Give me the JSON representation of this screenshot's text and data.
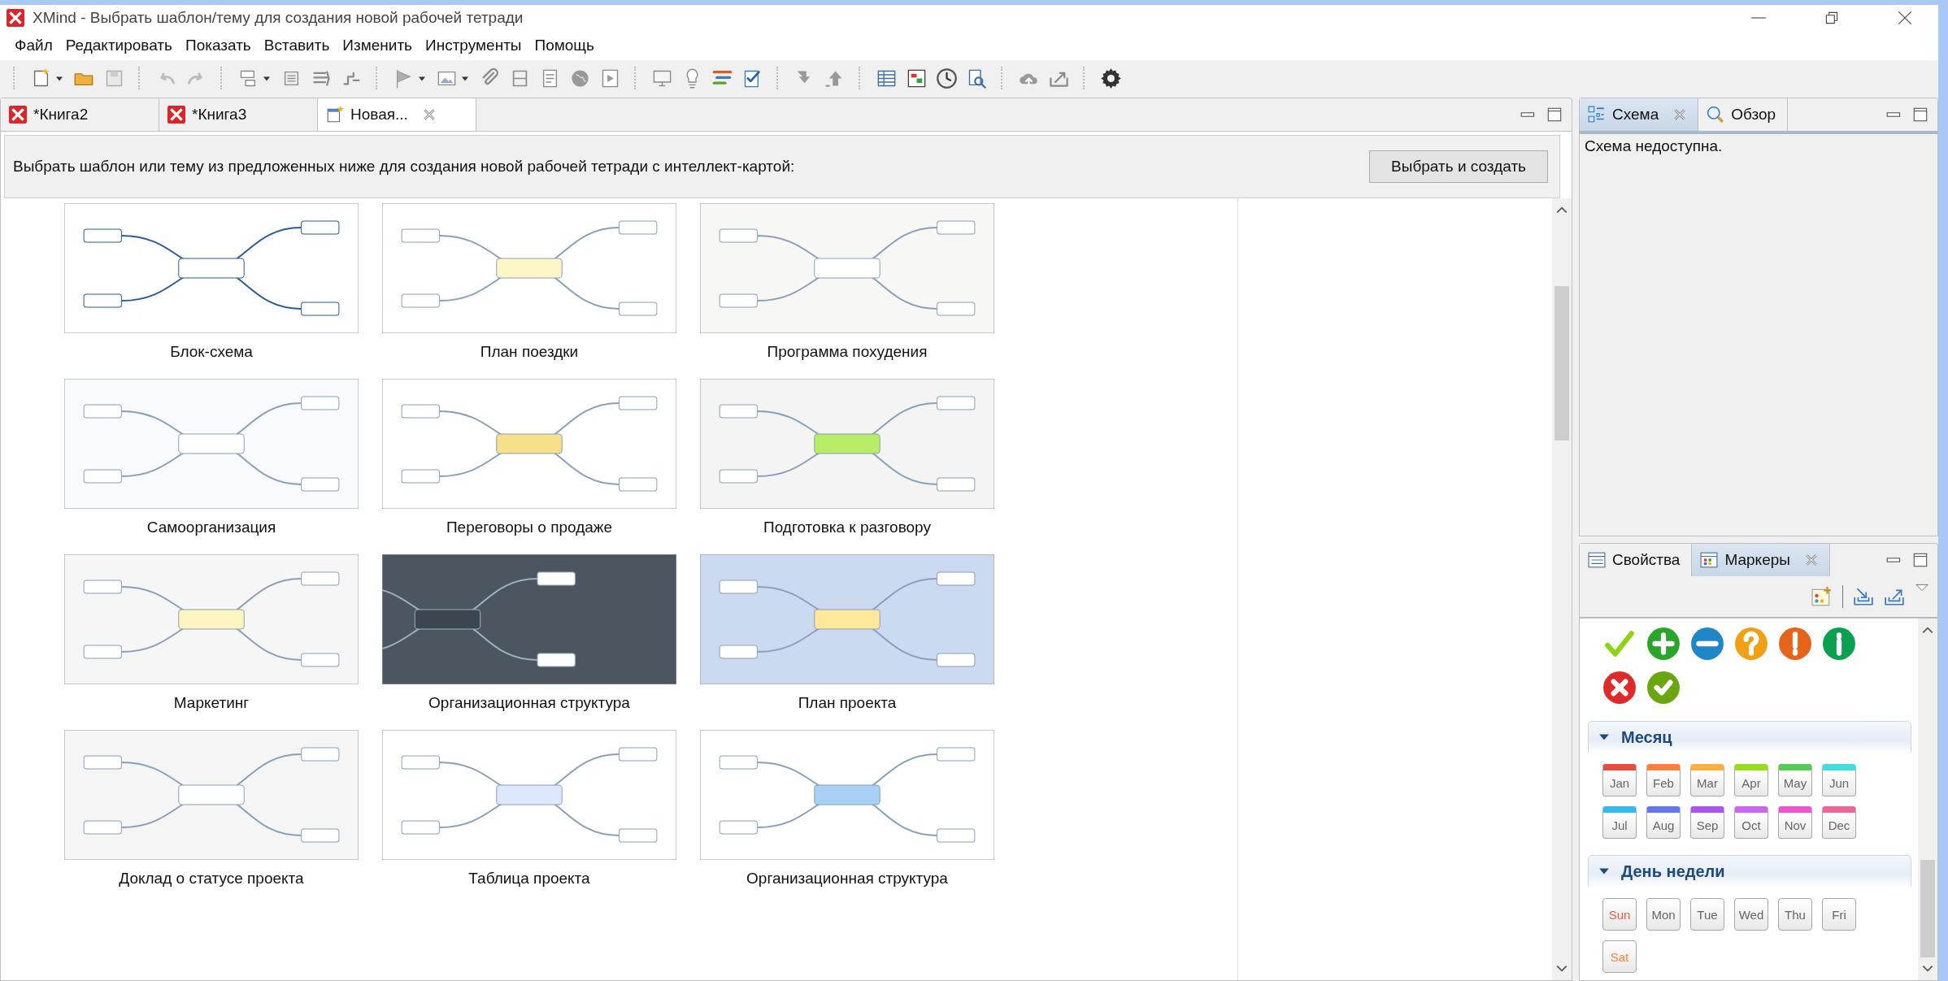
{
  "window": {
    "title": "XMind - Выбрать шаблон/тему для создания новой рабочей тетради"
  },
  "menu": [
    "Файл",
    "Редактировать",
    "Показать",
    "Вставить",
    "Изменить",
    "Инструменты",
    "Помощь"
  ],
  "editor_tabs": [
    {
      "label": "*Книга2",
      "kind": "workbook",
      "selected": false
    },
    {
      "label": "*Книга3",
      "kind": "workbook",
      "selected": false
    },
    {
      "label": "Новая...",
      "kind": "new",
      "selected": true
    }
  ],
  "template_chooser": {
    "prompt": "Выбрать шаблон или тему из предложенных ниже для создания новой рабочей тетради с интеллект-картой:",
    "button": "Выбрать и создать",
    "templates": [
      {
        "name": "Блок-схема",
        "kind": "picture"
      },
      {
        "name": "План поездки",
        "kind": "picture"
      },
      {
        "name": "Программа похудения",
        "kind": "picture"
      },
      {
        "name": "Самоорганизация",
        "kind": "picture"
      },
      {
        "name": "Переговоры о продаже",
        "kind": "picture"
      },
      {
        "name": "Подготовка к разговору",
        "kind": "picture"
      },
      {
        "name": "Маркетинг",
        "kind": "picture"
      },
      {
        "name": "Организационная структура",
        "kind": "picture"
      },
      {
        "name": "План проекта",
        "kind": "picture"
      },
      {
        "name": "Доклад о статусе проекта",
        "kind": "picture"
      },
      {
        "name": "Таблица проекта",
        "kind": "picture"
      },
      {
        "name": "Организационная структура",
        "kind": "picture"
      }
    ]
  },
  "outline_panel": {
    "tabs": [
      {
        "label": "Схема",
        "kind": "outline",
        "selected": true
      },
      {
        "label": "Обзор",
        "kind": "overview",
        "selected": false
      }
    ],
    "message": "Схема недоступна."
  },
  "markers_panel": {
    "tabs": [
      {
        "label": "Свойства",
        "kind": "properties",
        "selected": false
      },
      {
        "label": "Маркеры",
        "kind": "markers",
        "selected": true
      }
    ],
    "groups": [
      {
        "title": "Месяц",
        "kind": "month",
        "expanded": true,
        "items": [
          {
            "label": "Jan",
            "color": "#e84c3d"
          },
          {
            "label": "Feb",
            "color": "#ff8040"
          },
          {
            "label": "Mar",
            "color": "#ffb040"
          },
          {
            "label": "Apr",
            "color": "#99dd22"
          },
          {
            "label": "May",
            "color": "#55cc55"
          },
          {
            "label": "Jun",
            "color": "#44dddd"
          },
          {
            "label": "Jul",
            "color": "#33bbee"
          },
          {
            "label": "Aug",
            "color": "#6677ee"
          },
          {
            "label": "Sep",
            "color": "#aa55ee"
          },
          {
            "label": "Oct",
            "color": "#cc66ee"
          },
          {
            "label": "Nov",
            "color": "#ee55cc"
          },
          {
            "label": "Dec",
            "color": "#ee6699"
          }
        ]
      },
      {
        "title": "День недели",
        "kind": "weekday",
        "expanded": true,
        "items": [
          {
            "label": "Sun",
            "color": "#f05a3c"
          },
          {
            "label": "Mon",
            "color": "#666666"
          },
          {
            "label": "Tue",
            "color": "#666666"
          },
          {
            "label": "Wed",
            "color": "#666666"
          },
          {
            "label": "Thu",
            "color": "#666666"
          },
          {
            "label": "Fri",
            "color": "#666666"
          },
          {
            "label": "Sat",
            "color": "#ff8040"
          }
        ]
      }
    ]
  }
}
